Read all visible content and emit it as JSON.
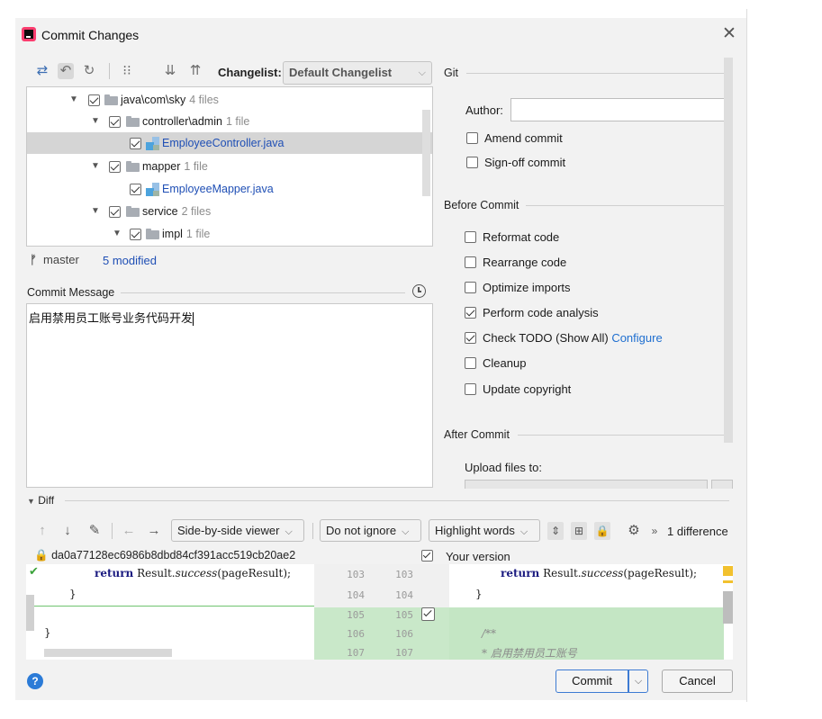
{
  "window": {
    "title": "Commit Changes"
  },
  "toolbar": {
    "changelist_label": "Changelist:",
    "changelist_value": "Default Changelist"
  },
  "tree": [
    {
      "label": "java\\com\\sky",
      "count": "4 files"
    },
    {
      "label": "controller\\admin",
      "count": "1 file"
    },
    {
      "label": "EmployeeController.java",
      "count": ""
    },
    {
      "label": "mapper",
      "count": "1 file"
    },
    {
      "label": "EmployeeMapper.java",
      "count": ""
    },
    {
      "label": "service",
      "count": "2 files"
    },
    {
      "label": "impl",
      "count": "1 file"
    }
  ],
  "status": {
    "branch": "master",
    "modified": "5 modified"
  },
  "commit_message": {
    "label": "Commit Message",
    "text": "启用禁用员工账号业务代码开发"
  },
  "git": {
    "section": "Git",
    "author_label": "Author:",
    "author_value": "",
    "amend": "Amend commit",
    "signoff": "Sign-off commit"
  },
  "before_commit": {
    "section": "Before Commit",
    "options": [
      {
        "label": "Reformat code",
        "checked": false
      },
      {
        "label": "Rearrange code",
        "checked": false
      },
      {
        "label": "Optimize imports",
        "checked": false
      },
      {
        "label": "Perform code analysis",
        "checked": true
      },
      {
        "label": "Check TODO (Show All)",
        "checked": true,
        "link": "Configure"
      },
      {
        "label": "Cleanup",
        "checked": false
      },
      {
        "label": "Update copyright",
        "checked": false
      }
    ]
  },
  "after_commit": {
    "section": "After Commit",
    "upload_label": "Upload files to:"
  },
  "diff": {
    "section": "Diff",
    "viewer": "Side-by-side viewer",
    "ignore": "Do not ignore",
    "highlight": "Highlight words",
    "differences": "1 difference",
    "left_header": "da0a77128ec6986b8dbd84cf391acc519cb20ae2",
    "right_header": "Your version",
    "left_lines": [
      {
        "n": "103",
        "kw": "return",
        "text": " Result.",
        "it": "success",
        "tail": "(pageResult);"
      },
      {
        "n": "104",
        "kw": "",
        "text": "}",
        "it": "",
        "tail": ""
      },
      {
        "n": "105",
        "kw": "",
        "text": "",
        "it": "",
        "tail": ""
      },
      {
        "n": "106",
        "kw": "",
        "text": "}",
        "it": "",
        "tail": ""
      },
      {
        "n": "107",
        "kw": "",
        "text": "",
        "it": "",
        "tail": ""
      }
    ],
    "right_lines": [
      {
        "n": "103",
        "kw": "return",
        "text": " Result.",
        "it": "success",
        "tail": "(pageResult);"
      },
      {
        "n": "104",
        "kw": "",
        "text": "}",
        "it": "",
        "tail": ""
      },
      {
        "n": "105",
        "kw": "",
        "text": "",
        "it": "",
        "tail": ""
      },
      {
        "n": "106",
        "kw": "",
        "text": "/**",
        "it": "",
        "tail": ""
      },
      {
        "n": "107",
        "kw": "",
        "text": "* 启用禁用员工账号",
        "it": "",
        "tail": ""
      }
    ]
  },
  "buttons": {
    "commit": "Commit",
    "cancel": "Cancel",
    "help": "?"
  },
  "colors": {
    "accent": "#1f4fb5",
    "added": "#c4e6c4",
    "link": "#1f6fd0"
  }
}
